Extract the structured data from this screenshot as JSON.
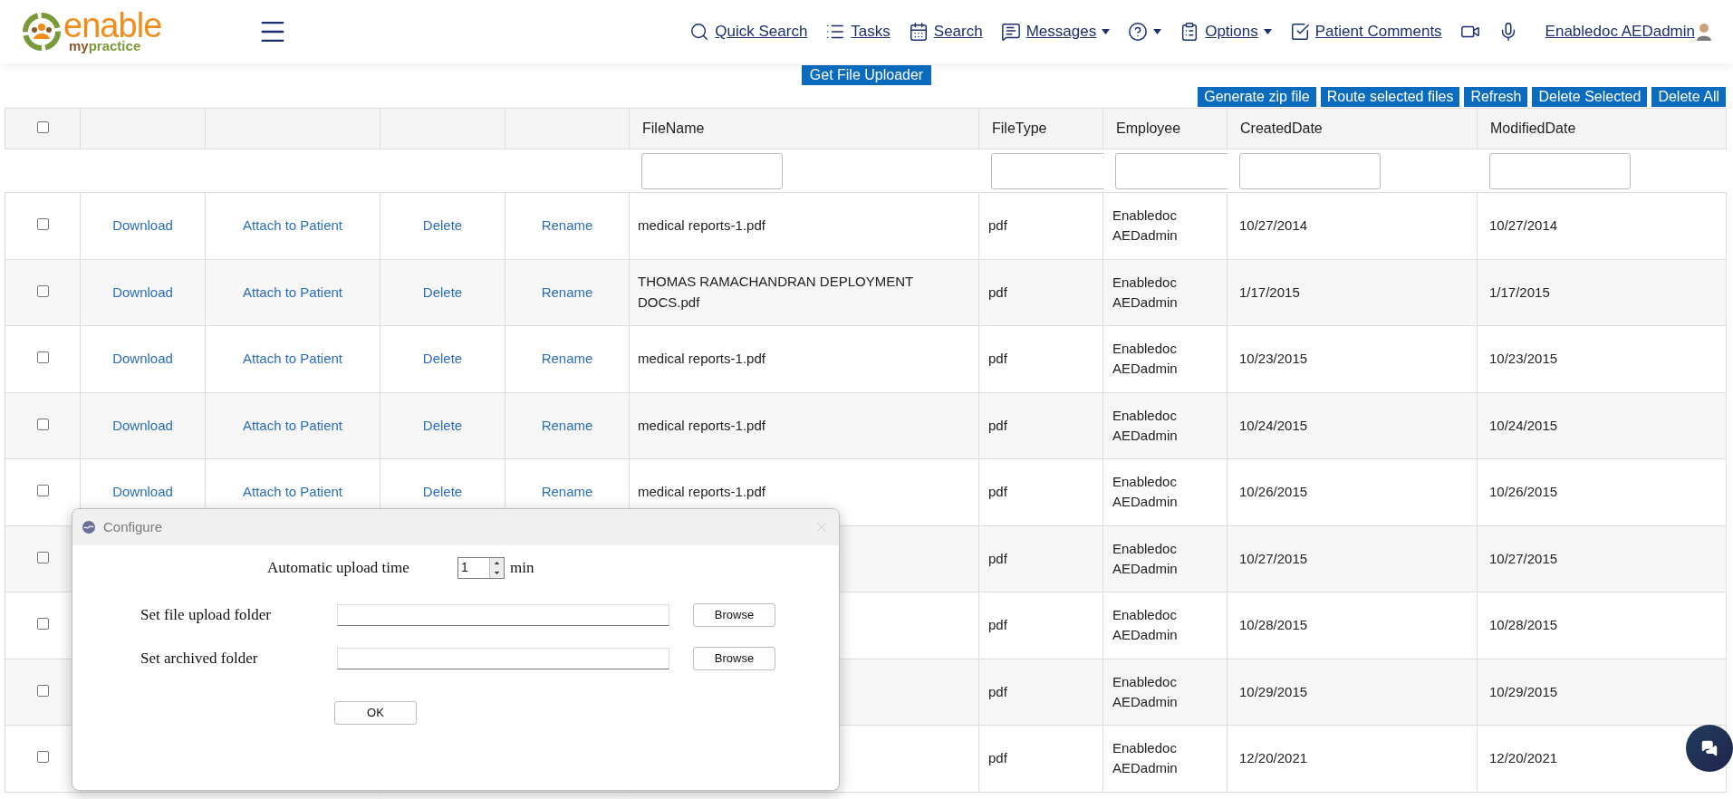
{
  "logo": {
    "word": "enable",
    "sub_a": "my",
    "sub_b": "practice"
  },
  "nav": [
    {
      "kind": "quick_search",
      "label": "Quick Search",
      "dropdown": false
    },
    {
      "kind": "tasks",
      "label": "Tasks",
      "dropdown": false
    },
    {
      "kind": "search",
      "label": "Search",
      "dropdown": false
    },
    {
      "kind": "messages",
      "label": "Messages",
      "dropdown": true
    },
    {
      "kind": "help",
      "dropdown": true
    },
    {
      "kind": "options",
      "label": "Options",
      "dropdown": true
    },
    {
      "kind": "comments",
      "label": "Patient Comments",
      "dropdown": false
    },
    {
      "kind": "video"
    },
    {
      "kind": "mic"
    }
  ],
  "user": {
    "name": "Enabledoc AEDadmin"
  },
  "uploader_button": "Get File Uploader",
  "toolbar": [
    "Generate zip file",
    "Route selected files",
    "Refresh",
    "Delete Selected",
    "Delete All"
  ],
  "table": {
    "select_all": {
      "checked": false
    },
    "columns": [
      "FileName",
      "FileType",
      "Employee",
      "CreatedDate",
      "ModifiedDate"
    ],
    "rows": [
      {
        "checked": false,
        "download": "Download",
        "attach": "Attach to Patient",
        "delete": "Delete",
        "rename": "Rename",
        "filename": "medical reports-1.pdf",
        "filetype": "pdf",
        "employee": "Enabledoc AEDadmin",
        "created": "10/27/2014",
        "modified": "10/27/2014"
      },
      {
        "checked": false,
        "download": "Download",
        "attach": "Attach to Patient",
        "delete": "Delete",
        "rename": "Rename",
        "filename": "THOMAS RAMACHANDRAN DEPLOYMENT DOCS.pdf",
        "filetype": "pdf",
        "employee": "Enabledoc AEDadmin",
        "created": "1/17/2015",
        "modified": "1/17/2015"
      },
      {
        "checked": false,
        "download": "Download",
        "attach": "Attach to Patient",
        "delete": "Delete",
        "rename": "Rename",
        "filename": "medical reports-1.pdf",
        "filetype": "pdf",
        "employee": "Enabledoc AEDadmin",
        "created": "10/23/2015",
        "modified": "10/23/2015"
      },
      {
        "checked": false,
        "download": "Download",
        "attach": "Attach to Patient",
        "delete": "Delete",
        "rename": "Rename",
        "filename": "medical reports-1.pdf",
        "filetype": "pdf",
        "employee": "Enabledoc AEDadmin",
        "created": "10/24/2015",
        "modified": "10/24/2015"
      },
      {
        "checked": false,
        "download": "Download",
        "attach": "Attach to Patient",
        "delete": "Delete",
        "rename": "Rename",
        "filename": "medical reports-1.pdf",
        "filetype": "pdf",
        "employee": "Enabledoc AEDadmin",
        "created": "10/26/2015",
        "modified": "10/26/2015"
      },
      {
        "checked": false,
        "filetype": "pdf",
        "employee": "Enabledoc AEDadmin",
        "created": "10/27/2015",
        "modified": "10/27/2015"
      },
      {
        "checked": false,
        "filetype": "pdf",
        "employee": "Enabledoc AEDadmin",
        "created": "10/28/2015",
        "modified": "10/28/2015"
      },
      {
        "checked": false,
        "filetype": "pdf",
        "employee": "Enabledoc AEDadmin",
        "created": "10/29/2015",
        "modified": "10/29/2015"
      },
      {
        "checked": false,
        "filetype": "pdf",
        "employee": "Enabledoc AEDadmin",
        "created": "12/20/2021",
        "modified": "12/20/2021"
      }
    ]
  },
  "dialog": {
    "title": "Configure",
    "upload_time_label": "Automatic upload time",
    "upload_time_value": "1",
    "upload_time_unit": "min",
    "folders": [
      {
        "label": "Set file upload folder",
        "browse": "Browse"
      },
      {
        "label": "Set archived folder",
        "browse": "Browse"
      }
    ],
    "ok": "OK"
  }
}
